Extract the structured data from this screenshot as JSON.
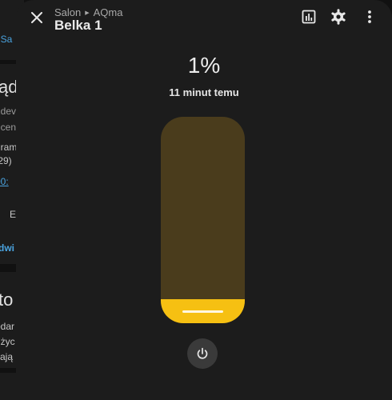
{
  "background": {
    "fragments": [
      ": Sa",
      "ąd",
      "2dev",
      "ucen",
      "gram",
      ":29)",
      "00:",
      "E",
      "dwi",
      "to",
      "odar",
      "użyc",
      "kają"
    ]
  },
  "dialog": {
    "breadcrumb": [
      "Salon",
      "AQma"
    ],
    "title": "Belka 1",
    "value": "1%",
    "last_changed": "11 minut temu",
    "position_percent": 1,
    "icons": {
      "close": "close-icon",
      "history": "chart-bar-icon",
      "settings": "gear-icon",
      "more": "dots-vertical-icon",
      "power": "power-icon"
    },
    "colors": {
      "accent": "#f6c012",
      "track": "#4a3c1c",
      "surface": "#1c1c1c"
    }
  }
}
